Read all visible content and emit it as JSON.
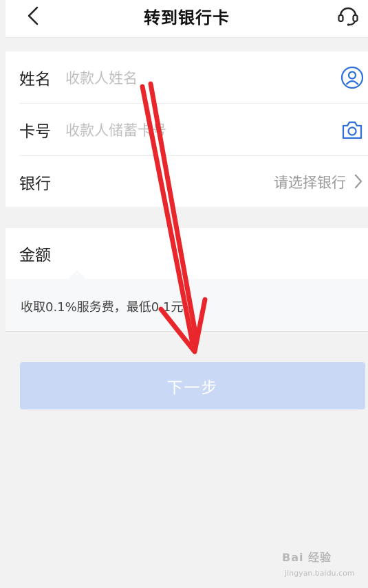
{
  "header": {
    "title": "转到银行卡",
    "back_icon": "chevron-left-icon",
    "service_icon": "headset-icon"
  },
  "form": {
    "name": {
      "label": "姓名",
      "placeholder": "收款人姓名",
      "icon": "contact-icon"
    },
    "card_number": {
      "label": "卡号",
      "placeholder": "收款人储蓄卡号",
      "icon": "camera-icon"
    },
    "bank": {
      "label": "银行",
      "placeholder": "请选择银行",
      "icon": "chevron-right-icon"
    }
  },
  "amount": {
    "label": "金额"
  },
  "fee_notice": "收取0.1%服务费，最低0.1元",
  "next_button": {
    "label": "下一步"
  },
  "watermark": {
    "brand": "Bai 经验",
    "url": "jingyan.baidu.com"
  },
  "colors": {
    "accent": "#2f6fdc",
    "button_disabled": "#c9d9f5",
    "annotation_arrow": "#e8262b"
  }
}
